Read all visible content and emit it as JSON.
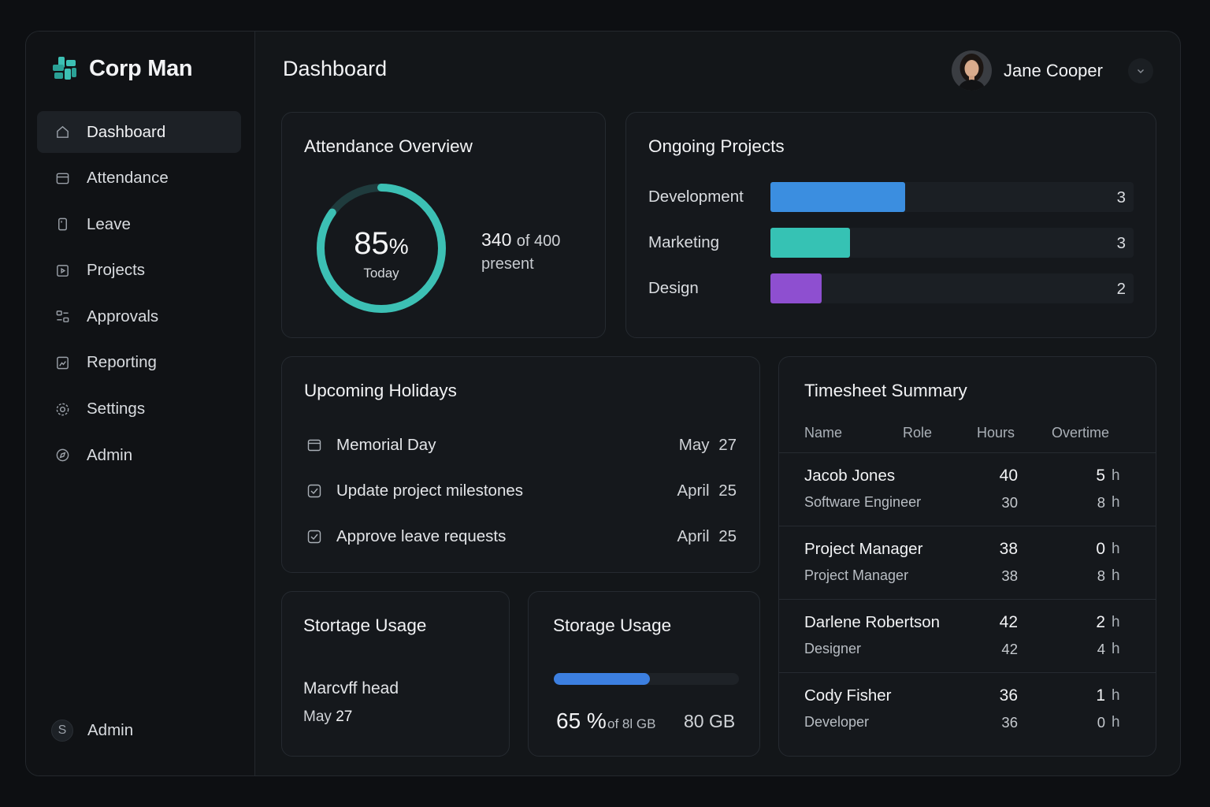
{
  "brand": {
    "name": "Corp Man",
    "accent": "#3cc0b4"
  },
  "sidebar": {
    "items": [
      {
        "label": "Dashboard",
        "icon": "home-icon",
        "active": true
      },
      {
        "label": "Attendance",
        "icon": "calendar-icon"
      },
      {
        "label": "Leave",
        "icon": "phone-icon"
      },
      {
        "label": "Projects",
        "icon": "play-square-icon"
      },
      {
        "label": "Approvals",
        "icon": "toggles-icon"
      },
      {
        "label": "Reporting",
        "icon": "report-icon"
      },
      {
        "label": "Settings",
        "icon": "gear-icon"
      },
      {
        "label": "Admin",
        "icon": "compass-icon"
      }
    ],
    "footer_user": {
      "initial": "S",
      "label": "Admin"
    }
  },
  "header": {
    "title": "Dashboard",
    "user_name": "Jane Cooper"
  },
  "attendance": {
    "title": "Attendance Overview",
    "percent": 85,
    "percent_text": "85",
    "percent_symbol": "%",
    "sub_label": "Today",
    "present_count": "340",
    "of_text": "of 400",
    "present_label": "present",
    "ring_color": "#3cc0b4"
  },
  "projects": {
    "title": "Ongoing Projects",
    "rows": [
      {
        "label": "Development",
        "count": "3",
        "fill_fraction": 0.37,
        "color": "#3b8ee0"
      },
      {
        "label": "Marketing",
        "count": "3",
        "fill_fraction": 0.22,
        "color": "#36c2b4"
      },
      {
        "label": "Design",
        "count": "2",
        "fill_fraction": 0.14,
        "color": "#8e4fd0"
      }
    ]
  },
  "holidays": {
    "title": "Upcoming Holidays",
    "rows": [
      {
        "name": "Memorial Day",
        "date": "May 27",
        "icon": "calendar-icon"
      },
      {
        "name": "Update project milestones",
        "date": "April 25",
        "icon": "checkbox-icon"
      },
      {
        "name": "Approve leave requests",
        "date": "April 25",
        "icon": "checkbox-icon"
      }
    ]
  },
  "storage_left": {
    "title": "Stortage Usage",
    "line1": "Marcvff head",
    "line2_month": "May",
    "line2_day": "27"
  },
  "storage_right": {
    "title": "Storage Usage",
    "percent": 65,
    "percent_text": "65 %",
    "of_text": "of 8l GB",
    "total": "80 GB",
    "bar_fraction": 0.52,
    "bar_color": "#3c7fe0"
  },
  "timesheet": {
    "title": "Timesheet Summary",
    "columns": [
      "Name",
      "Role",
      "Hours",
      "Overtime"
    ],
    "unit": "h",
    "rows": [
      {
        "name": "Jacob Jones",
        "role": "Software Engineer",
        "hours": "40",
        "hours2": "30",
        "ot": "5",
        "ot2": "8"
      },
      {
        "name": "Project Manager",
        "role": "Project Manager",
        "hours": "38",
        "hours2": "38",
        "ot": "0",
        "ot2": "8"
      },
      {
        "name": "Darlene Robertson",
        "role": "Designer",
        "hours": "42",
        "hours2": "42",
        "ot": "2",
        "ot2": "4"
      },
      {
        "name": "Cody Fisher",
        "role": "Developer",
        "hours": "36",
        "hours2": "36",
        "ot": "1",
        "ot2": "0"
      }
    ]
  }
}
